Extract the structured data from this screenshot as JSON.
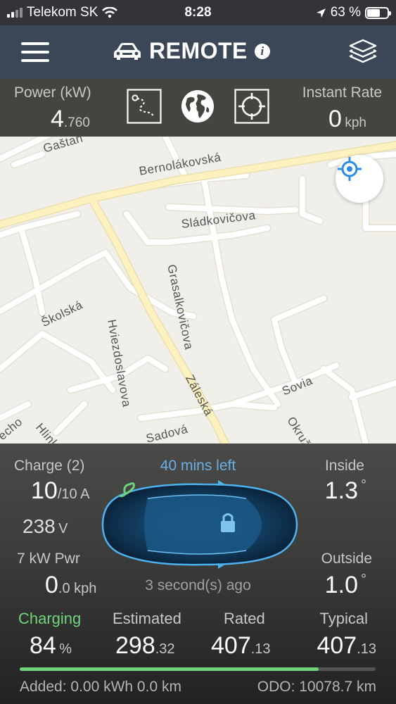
{
  "status_bar": {
    "carrier": "Telekom SK",
    "time": "8:28",
    "battery_percent": "63 %",
    "battery_level": 0.63
  },
  "header": {
    "title": "REMOTE",
    "info_icon": "i",
    "icons": [
      "menu-icon",
      "car-icon",
      "info-icon",
      "layers-icon"
    ]
  },
  "top_row": {
    "power_label": "Power (kW)",
    "power_int": "4",
    "power_dec": ".760",
    "rate_label": "Instant Rate",
    "rate_value": "0",
    "rate_unit": "kph",
    "icons": [
      "route-icon",
      "globe-icon",
      "crosshair-icon"
    ]
  },
  "map": {
    "streets": [
      "Gaštan",
      "Bernolákovská",
      "Sládkovičova",
      "Grasalkovičova",
      "Školská",
      "Hviezdoslavova",
      "Záleská",
      "Sovia",
      "Sadová",
      "Okruž",
      "Hlink",
      "echo"
    ],
    "colors": {
      "land": "#f1efea",
      "road": "#ffffff",
      "main_road": "#fdf0b0",
      "road_edge": "#e6e2d6"
    }
  },
  "panel": {
    "charge_label": "Charge (2)",
    "charge_amps": "10",
    "charge_amps_max": "/10 A",
    "voltage": "238",
    "voltage_unit": "V",
    "pwr_label": "7 kW Pwr",
    "speed_int": "0",
    "speed_dec": ".0 kph",
    "time_left": "40 mins left",
    "updated": "3 second(s) ago",
    "inside_label": "Inside",
    "inside_value": "1.3",
    "outside_label": "Outside",
    "outside_value": "1.0",
    "degree": "°",
    "charging_label": "Charging",
    "charging_value": "84",
    "charging_unit": "%",
    "estimated_label": "Estimated",
    "estimated_int": "298",
    "estimated_dec": ".32",
    "rated_label": "Rated",
    "rated_int": "407",
    "rated_dec": ".13",
    "typical_label": "Typical",
    "typical_int": "407",
    "typical_dec": ".13",
    "charge_progress": 0.84,
    "added": "Added: 0.00 kWh 0.0 km",
    "odo": "ODO: 10078.7 km",
    "colors": {
      "accent_blue": "#6aafe6",
      "charging_green": "#6fd37a"
    }
  }
}
